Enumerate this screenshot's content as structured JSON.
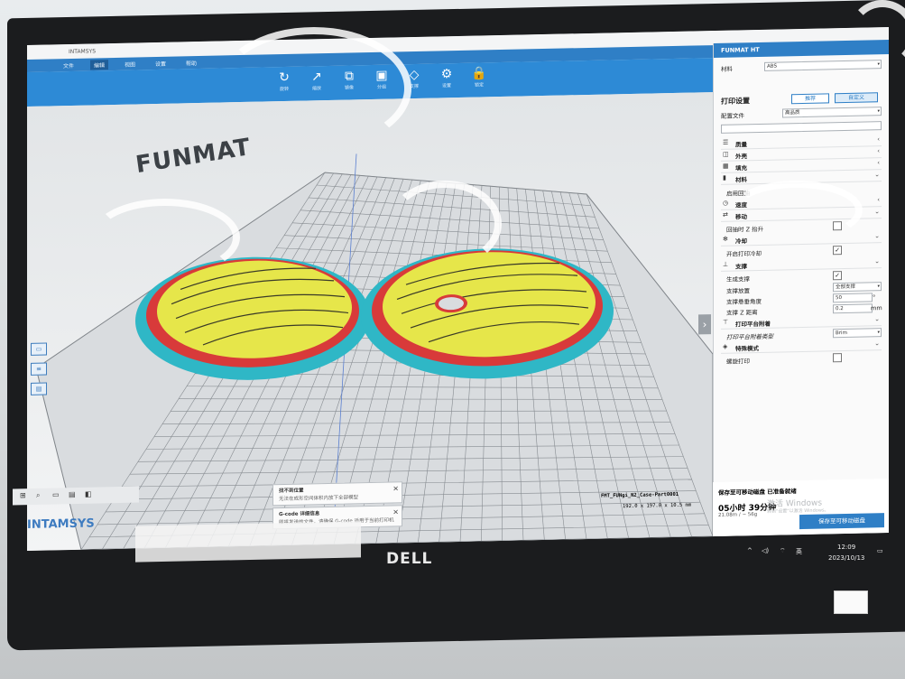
{
  "app": {
    "title": "INTAMSYS",
    "menu_tabs": [
      "文件",
      "编辑",
      "视图",
      "设置",
      "帮助"
    ],
    "toolbar": [
      {
        "label": "旋转",
        "icon": "rotate-icon"
      },
      {
        "label": "缩放",
        "icon": "scale-icon"
      },
      {
        "label": "镜像",
        "icon": "mirror-icon"
      },
      {
        "label": "分组",
        "icon": "group-icon"
      },
      {
        "label": "支撑",
        "icon": "support-icon"
      },
      {
        "label": "设置",
        "icon": "settings-icon"
      },
      {
        "label": "锁定",
        "icon": "lock-icon"
      }
    ],
    "brand_text": "FUNMAT",
    "logo_text": "INTAMSYS"
  },
  "panel": {
    "printer": "FUNMAT HT",
    "material_label": "材料",
    "material_value": "ABS",
    "print_settings_label": "打印设置",
    "recommended_label": "推荐",
    "custom_label": "自定义",
    "profile_label": "配置文件",
    "profile_value": "高品质",
    "sections": [
      {
        "label": "质量",
        "icon": "quality-icon",
        "chevron": "‹"
      },
      {
        "label": "外壳",
        "icon": "shell-icon",
        "chevron": "‹"
      },
      {
        "label": "填充",
        "icon": "infill-icon",
        "chevron": "‹"
      },
      {
        "label": "材料",
        "icon": "material-icon",
        "chevron": "⌄"
      }
    ],
    "auto_retract_label": "启用回抽",
    "speed_label": "速度",
    "travel_label": "移动",
    "z_hop_label": "回抽时 Z 抬升",
    "cooling_label": "冷却",
    "enable_fan_label": "开启打印冷却",
    "support_label": "支撑",
    "gen_support_label": "生成支撑",
    "support_placement_label": "支撑放置",
    "support_placement_value": "全部支撑",
    "overhang_angle_label": "支撑悬垂角度",
    "overhang_angle_value": "50",
    "overhang_angle_unit": "°",
    "z_distance_label": "支撑 Z 距离",
    "z_distance_value": "0.2",
    "z_distance_unit": "mm",
    "adhesion_section_label": "打印平台附着",
    "adhesion_type_label": "打印平台附着类型",
    "adhesion_type_value": "Brim",
    "special_modes_label": "特殊模式",
    "spiralize_label": "螺旋打印"
  },
  "model": {
    "name": "FMT_FUNgi_N2_Case-Part0001",
    "dimensions": "192.0 x 197.0 x 10.5 mm"
  },
  "estimate": {
    "ready_text": "保存至可移动磁盘 已准备就绪",
    "time": "05小时 39分钟",
    "material": "21.08m / ~ 56g",
    "save_button": "保存至可移动磁盘"
  },
  "toasts": [
    {
      "title": "找不到位置",
      "body": "无法在成形空间体积内放下全部模型"
    },
    {
      "title": "G-code 详细信息",
      "body": "即将发送的文件，请确保 G-code 适用于当前打印机"
    }
  ],
  "taskbar": {
    "time": "12:09",
    "date": "2023/10/13",
    "ime": "英"
  },
  "activation": {
    "line1": "激活 Windows",
    "line2": "转到\"设置\"以激活 Windows。"
  },
  "monitor_brand": "DELL",
  "colors": {
    "accent": "#2f7fc6",
    "model_fill": "#e6e64a",
    "model_wall": "#d83a3a",
    "brim": "#2fb7c6",
    "grid": "#7f8489"
  }
}
